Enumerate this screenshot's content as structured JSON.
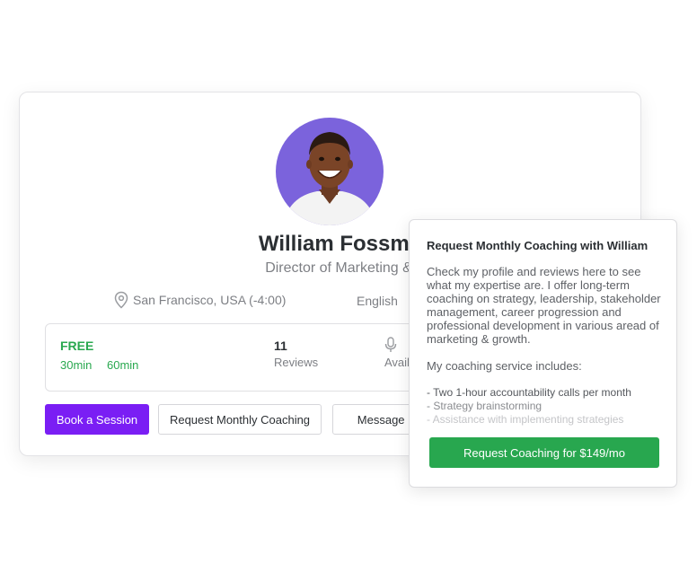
{
  "profile": {
    "name": "William Fossmaker",
    "title": "Director of Marketing & Growth",
    "location": "San Francisco, USA (-4:00)",
    "language": "English"
  },
  "stats": {
    "price_label": "FREE",
    "durations": [
      "30min",
      "60min"
    ],
    "reviews_count": "11",
    "reviews_label": "Reviews",
    "availability_label": "Available"
  },
  "actions": {
    "book_label": "Book a Session",
    "request_label": "Request Monthly Coaching",
    "message_label": "Message Me"
  },
  "popup": {
    "title": "Request Monthly Coaching with William",
    "body": "Check my profile and reviews here to see what my expertise are. I offer long-term coaching on strategy, leadership, stakeholder management, career progression and professional development in various aread of marketing & growth.",
    "includes_label": "My coaching service includes:",
    "items": [
      "-  Two 1-hour accountability calls per month",
      "-  Strategy brainstorming",
      "-  Assistance with implementing strategies"
    ],
    "cta_label": "Request Coaching for $149/mo"
  },
  "colors": {
    "primary": "#7a1ef4",
    "success": "#28a74f",
    "avatar_bg": "#7b63dc"
  }
}
